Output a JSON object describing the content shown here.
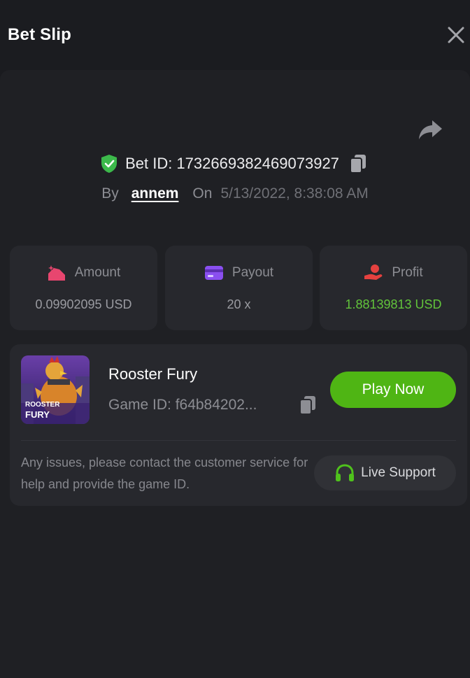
{
  "header": {
    "title": "Bet Slip",
    "close_icon": "close-icon"
  },
  "bet": {
    "id_text": "Bet ID: 1732669382469073927",
    "by_label": "By",
    "username": "annem",
    "on_label": "On",
    "date": "5/13/2022, 8:38:08 AM"
  },
  "stats": [
    {
      "label": "Amount",
      "value": "0.09902095 USD",
      "icon": "amount-icon"
    },
    {
      "label": "Payout",
      "value": "20 x",
      "icon": "payout-icon"
    },
    {
      "label": "Profit",
      "value": "1.88139813 USD",
      "icon": "profit-icon"
    }
  ],
  "game": {
    "name": "Rooster Fury",
    "id_text": "Game ID: f64b84202...",
    "thumb_text_1": "ROOSTER",
    "thumb_text_2": "FURY",
    "play_label": "Play Now",
    "notice": "Any issues, please contact the customer service for help and provide the game ID.",
    "support_label": "Live Support"
  },
  "colors": {
    "accent_green": "#4fb514",
    "profit_green": "#62c43b",
    "shield_green": "#3cb94b",
    "amount_pink": "#e8466f",
    "payout_purple": "#8a4ff0",
    "profit_red": "#e5413f"
  }
}
